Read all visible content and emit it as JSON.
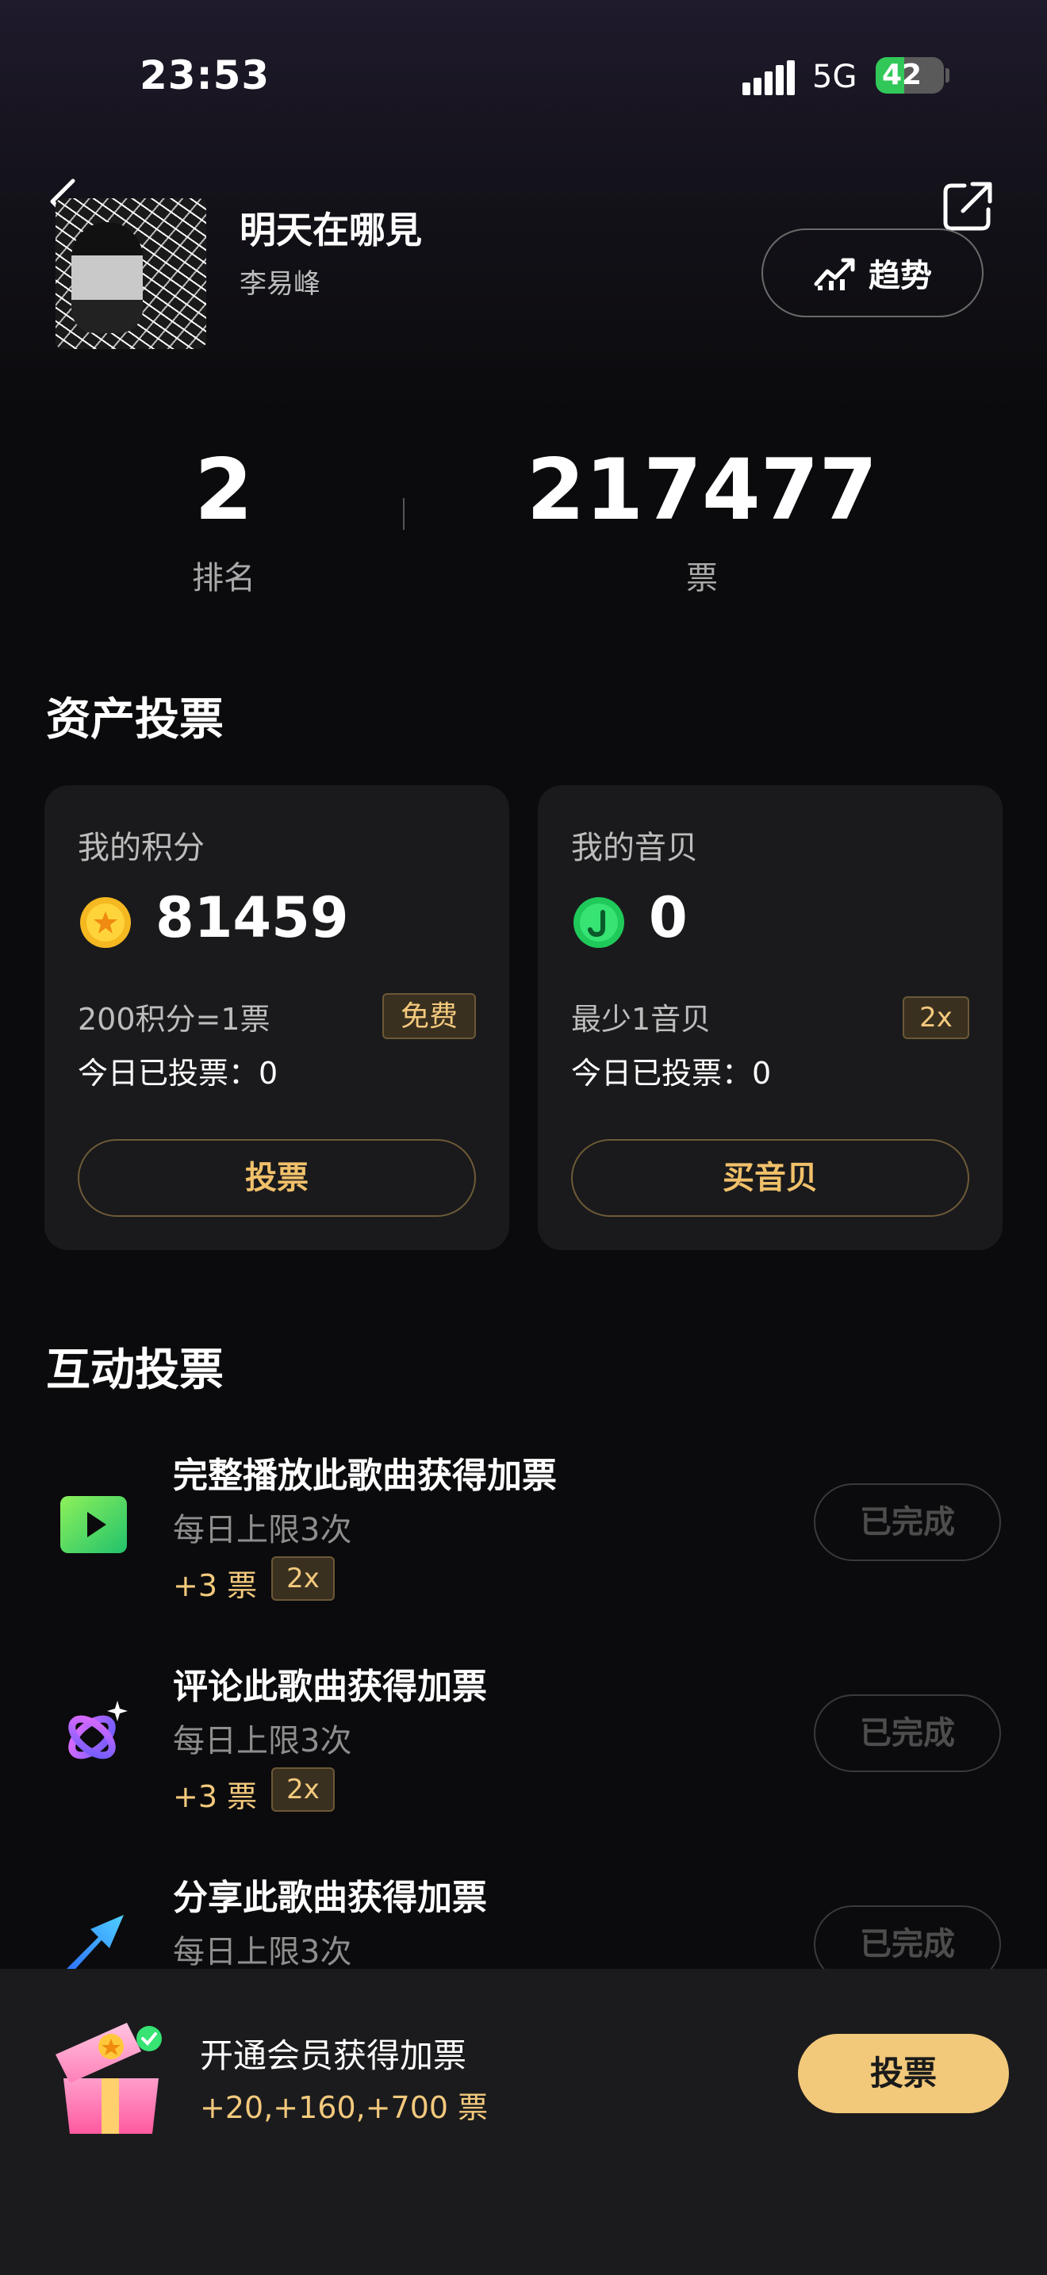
{
  "status_bar": {
    "time": "23:53",
    "network": "5G",
    "battery": "42",
    "battery_level": 0.42
  },
  "song": {
    "title": "明天在哪見",
    "artist": "李易峰"
  },
  "header": {
    "trend_label": "趋势"
  },
  "stats": {
    "rank": "2",
    "rank_label": "排名",
    "votes": "217477",
    "votes_label": "票"
  },
  "asset_voting": {
    "title": "资产投票",
    "points_card": {
      "title": "我的积分",
      "value": "81459",
      "rate": "200积分=1票",
      "tag": "免费",
      "today": "今日已投票：0",
      "button": "投票"
    },
    "coin_card": {
      "title": "我的音贝",
      "value": "0",
      "rate": "最少1音贝",
      "tag": "2x",
      "today": "今日已投票：0",
      "button": "买音贝"
    }
  },
  "interactive_voting": {
    "title": "互动投票",
    "tasks": [
      {
        "title": "完整播放此歌曲获得加票",
        "limit": "每日上限3次",
        "bonus": "+3 票",
        "multiplier": "2x",
        "status": "已完成"
      },
      {
        "title": "评论此歌曲获得加票",
        "limit": "每日上限3次",
        "bonus": "+3 票",
        "multiplier": "2x",
        "status": "已完成"
      },
      {
        "title": "分享此歌曲获得加票",
        "limit": "每日上限3次",
        "status": "已完成"
      }
    ]
  },
  "promo": {
    "title": "开通会员获得加票",
    "bonus": "+20,+160,+700 票",
    "button": "投票"
  },
  "colors": {
    "accent_gold": "#f2c97a",
    "background": "#0b0b0d",
    "card": "#1a1a1c"
  }
}
